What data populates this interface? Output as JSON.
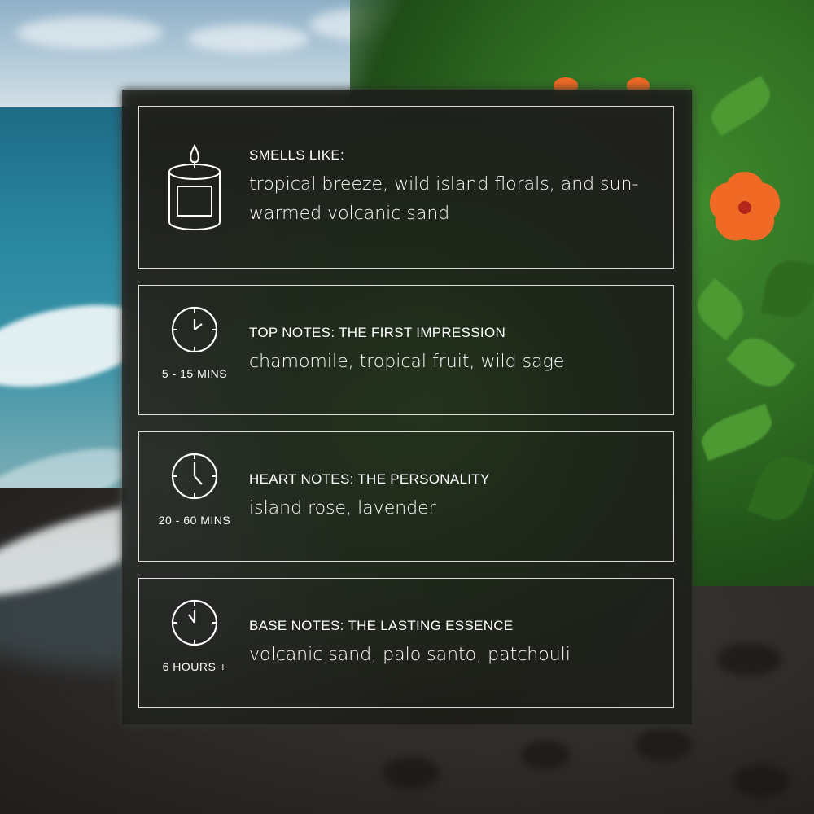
{
  "cards": [
    {
      "icon": "candle-icon",
      "heading": "SMELLS LIKE:",
      "notes": "tropical breeze, wild island florals, and sun-warmed volcanic sand",
      "duration": ""
    },
    {
      "icon": "clock-icon",
      "heading": "TOP NOTES: THE FIRST IMPRESSION",
      "notes": "chamomile, tropical fruit, wild sage",
      "duration": "5 - 15 MINS"
    },
    {
      "icon": "clock-icon",
      "heading": "HEART NOTES: THE PERSONALITY",
      "notes": "island rose, lavender",
      "duration": "20 - 60 MINS"
    },
    {
      "icon": "clock-icon",
      "heading": "BASE NOTES: THE LASTING ESSENCE",
      "notes": "volcanic sand, palo santo, patchouli",
      "duration": "6 HOURS +"
    }
  ],
  "colors": {
    "panel_overlay": "#161614",
    "card_border": "#ffffff",
    "text": "#ffffff",
    "hibiscus": "#f06a26"
  }
}
